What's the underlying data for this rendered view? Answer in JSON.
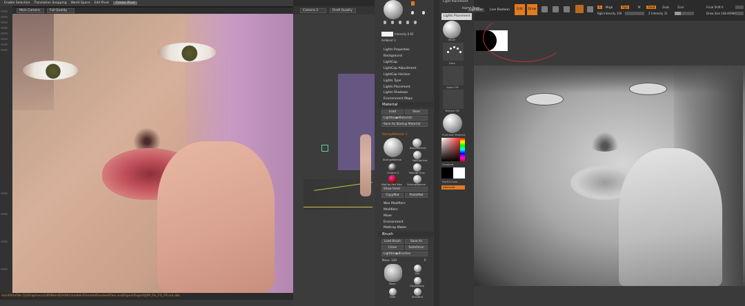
{
  "left_toolbar": {
    "items": [
      "Enable Selection",
      "Translation Snapping",
      "World Space",
      "Edit Pivot",
      "Center Pivot"
    ]
  },
  "left_viewport": {
    "camera_dropdown": "Main Camera",
    "quality_dropdown": "Full Quality",
    "file_path": "resnfidAnFile (5)/Drapheco/LURIN/entE/H0KL/models/Female/Rosalee/Files.ura/Export/Export/JXP_Fin_FG_FR.ura.abc"
  },
  "mid_viewport": {
    "camera_dropdown": "Camera 2",
    "quality_dropdown": "Draft Quality"
  },
  "palette_left": {
    "intensity_label": "Intensity 0.65",
    "ambient_label": "Ambient 3",
    "light_menu": [
      "Lights Properties",
      "Background",
      "LightCap",
      "LightCap Adjustment",
      "LightCap Horizon",
      "Lights Type",
      "Lights Placement",
      "Lights Shadows",
      "Environment Maps"
    ],
    "material": {
      "title": "Material",
      "load": "Load",
      "save": "Save",
      "lightbox_materials": "Lightbox▶Materials",
      "save_as_startup": "Save As Startup Material",
      "current_material": "StartupMaterial: 3",
      "materials": [
        "StartupMaterial",
        "MatCapGray",
        "Chrome A",
        "MatCap Gray",
        "MatCap Red Wax",
        "StartupMaterial"
      ],
      "basic_label": "BasicMaterial",
      "show_used": "Show Used",
      "copy_mat": "CopyMat",
      "paste_mat": "PasteMat",
      "sub_menu": [
        "Wax Modifiers",
        "Modifiers",
        "Mixer",
        "Environment",
        "Mattcap Maker"
      ]
    },
    "brush": {
      "title": "Brush",
      "load": "Load Brush",
      "save": "Save As",
      "clone": "Clone",
      "select_icon": "SelectIcon",
      "lightbox_brushes": "Lightbox▶Brushes",
      "move_label": "Move. 129",
      "r_label": "R",
      "brushes": [
        "Move",
        "Clay",
        "ClayBuildup",
        "Dam",
        "Standard"
      ]
    }
  },
  "palette_right": {
    "title": "Light Placement",
    "tooltip": "Lights Placement",
    "thumbs": [
      "Move",
      "Dots",
      "Alpha Off",
      "Texture Off",
      "FlatColor Material",
      "Gradient",
      "SwitchColor",
      "Alternate"
    ]
  },
  "zbrush": {
    "modes": [
      "Edit",
      "Draw",
      "Move",
      "Scale",
      "Rotate"
    ],
    "tabs": [
      "Home Page",
      "LightBox",
      "Live Boolean"
    ],
    "mrgb": "Mrgb",
    "rgb": "Rgb",
    "m": "M",
    "zadd": "Zadd",
    "zsub": "Zsub",
    "zcut": "Zcut",
    "a_label": "A",
    "rgb_intensity": "Rgb Intensity 100",
    "z_intensity": "Z Intensity 31",
    "focal_shift": "Focal Shift 0",
    "draw_size": "Draw Size 148.40984"
  },
  "colors": {
    "accent_orange": "#e27a1f",
    "path_orange": "#e08a3a",
    "bg_dark": "#2a2a2a",
    "panel": "#393939"
  }
}
